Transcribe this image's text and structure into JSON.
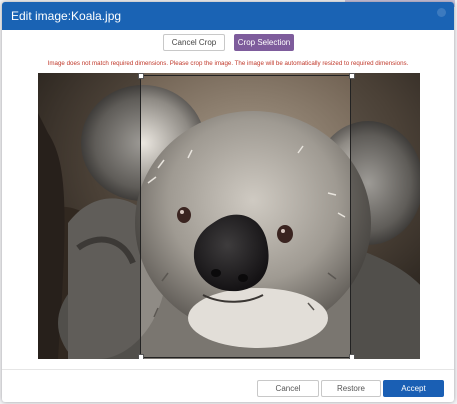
{
  "dialog": {
    "title": "Edit image:Koala.jpg",
    "close_icon": "close-icon"
  },
  "toolbar": {
    "cancel_crop_label": "Cancel Crop",
    "crop_selection_label": "Crop Selection"
  },
  "warning_text": "Image does not match required dimensions. Please crop the image. The image will be automatically resized to required dimensions.",
  "image": {
    "subject": "koala-photo"
  },
  "footer": {
    "cancel_label": "Cancel",
    "restore_label": "Restore",
    "accept_label": "Accept"
  },
  "colors": {
    "title_bar": "#1a63b4",
    "crop_selection_button": "#7e5c9c",
    "accept_button": "#1a5fb4",
    "warning_text": "#c0392b"
  }
}
